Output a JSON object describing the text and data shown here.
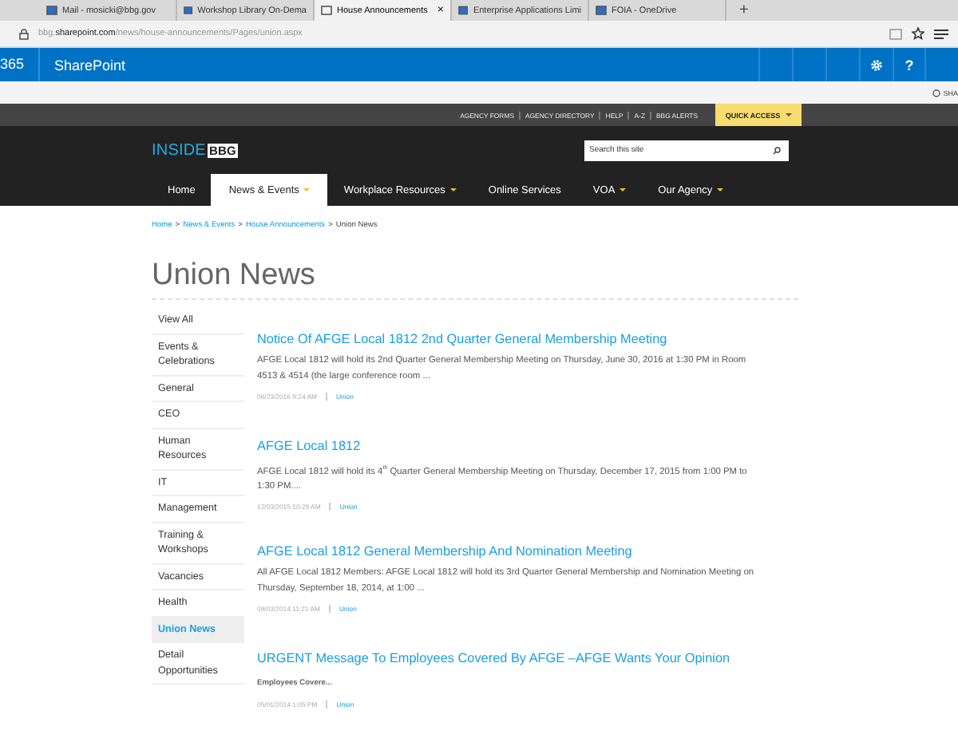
{
  "browser": {
    "tabs": [
      {
        "label": "Mail - mosicki@bbg.gov",
        "selected": false
      },
      {
        "label": "Workshop Library On-Dema",
        "selected": false
      },
      {
        "label": "House Announcements",
        "selected": true,
        "close": "×"
      },
      {
        "label": "Enterprise Applications Limi",
        "selected": false
      },
      {
        "label": "FOIA - OneDrive",
        "selected": false
      }
    ],
    "new_tab": "+",
    "address": "bbg.**sharepoint.com**/news/house-announcements/Pages/union.aspx"
  },
  "suite_bar": {
    "app_number": "365",
    "app": "SharePoint",
    "help": "?"
  },
  "ribbon": {
    "share": "SHA"
  },
  "utility_links": [
    "AGENCY FORMS",
    "AGENCY DIRECTORY",
    "HELP",
    "A-Z",
    "BBG ALERTS"
  ],
  "quick_access": {
    "label": "QUICK ACCESS",
    "has_menu": true
  },
  "logo": {
    "text": "INSIDE",
    "badge": "BBG"
  },
  "search": {
    "placeholder": "Search this site"
  },
  "nav": [
    {
      "label": "Home",
      "selected": false,
      "has_menu": false
    },
    {
      "label": "News & Events",
      "selected": true,
      "has_menu": true
    },
    {
      "label": "Workplace Resources",
      "selected": false,
      "has_menu": true
    },
    {
      "label": "Online Services",
      "selected": false,
      "has_menu": false
    },
    {
      "label": "VOA",
      "selected": false,
      "has_menu": true
    },
    {
      "label": "Our Agency",
      "selected": false,
      "has_menu": true
    }
  ],
  "breadcrumb": {
    "separator": ">",
    "items": [
      {
        "label": "Home",
        "link": true
      },
      {
        "label": "News & Events",
        "link": true
      },
      {
        "label": "House Announcements",
        "link": true
      },
      {
        "label": "Union News",
        "link": false
      }
    ]
  },
  "page_title": "Union News",
  "sidebar": [
    {
      "label": "View All",
      "selected": false
    },
    {
      "label": "Events & Celebrations",
      "selected": false
    },
    {
      "label": "General",
      "selected": false
    },
    {
      "label": "CEO",
      "selected": false
    },
    {
      "label": "Human Resources",
      "selected": false
    },
    {
      "label": "IT",
      "selected": false
    },
    {
      "label": "Management",
      "selected": false
    },
    {
      "label": "Training & Workshops",
      "selected": false
    },
    {
      "label": "Vacancies",
      "selected": false
    },
    {
      "label": "Health",
      "selected": false
    },
    {
      "label": "Union News",
      "selected": true
    },
    {
      "label": "Detail Opportunities",
      "selected": false
    }
  ],
  "articles": [
    {
      "title": "Notice Of AFGE Local 1812 2nd Quarter General Membership Meeting",
      "kind": "summary",
      "summary": "AFGE Local 1812 will hold its 2nd Quarter General Membership Meeting on Thursday, June 30, 2016 at 1:30 PM in Room 4513 & 4514 (the large conference room ...",
      "date": "06/23/2016 9:24 AM",
      "category": "Union"
    },
    {
      "title": "AFGE Local 1812",
      "kind": "summary",
      "summary": "AFGE Local 1812 will hold its 4$^{th}$ Quarter General Membership Meeting on Thursday, December 17, 2015 from 1:00 PM to 1:30 PM....",
      "date": "12/03/2015 10:29 AM",
      "category": "Union"
    },
    {
      "title": "AFGE Local 1812 General Membership And Nomination Meeting",
      "kind": "summary",
      "summary": "All AFGE Local 1812 Members: AFGE Local 1812 will hold its 3rd Quarter General Membership and Nomination Meeting on Thursday, September 18, 2014, at 1:00 ...",
      "date": "09/03/2014 11:21 AM",
      "category": "Union"
    },
    {
      "title": "URGENT Message To Employees Covered By AFGE –AFGE Wants Your Opinion",
      "kind": "teaser",
      "summary": "Employees Covere...",
      "date": "05/01/2014 1:05 PM",
      "category": "Union"
    }
  ]
}
